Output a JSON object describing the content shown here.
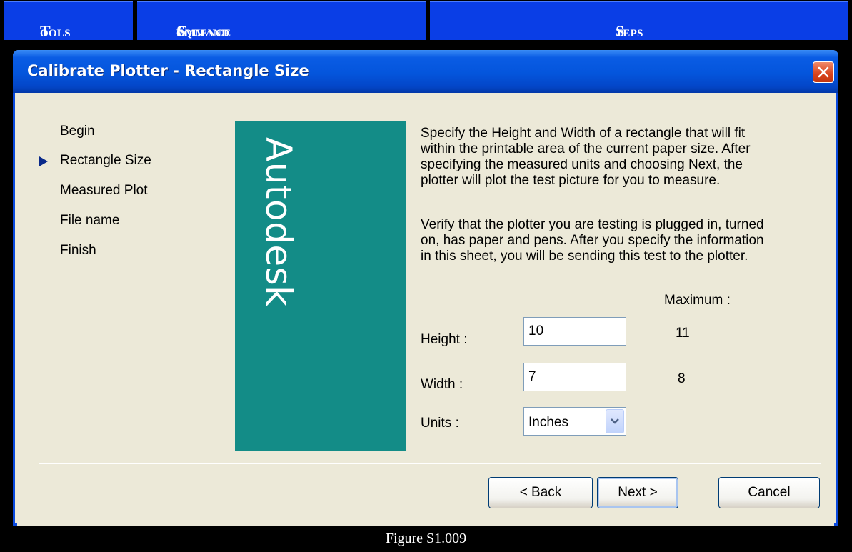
{
  "nav": {
    "tools": {
      "cap": "T",
      "rest": "ools"
    },
    "command_sequence": {
      "cap1": "C",
      "rest1": "ommand ",
      "cap2": "S",
      "rest2": "equence"
    },
    "steps": {
      "cap": "S",
      "rest": "teps"
    },
    "color": "#0a3ee6"
  },
  "dialog": {
    "title": "Calibrate Plotter - Rectangle Size",
    "steps": [
      "Begin",
      "Rectangle Size",
      "Measured Plot",
      "File name",
      "Finish"
    ],
    "current_step": "Rectangle Size",
    "banner": {
      "text": "Autodesk",
      "color": "#138c87"
    },
    "paragraph1": [
      "Specify the Height and Width of a rectangle that will fit",
      "within the printable area of the current paper size. After",
      "specifying the measured units and choosing Next, the",
      "plotter will plot the test picture for you to measure."
    ],
    "paragraph2": [
      "Verify that the plotter you are testing is plugged in, turned",
      "on, has paper and pens. After you specify the information",
      "in this sheet, you will be sending this test to the plotter."
    ],
    "maximum_label": "Maximum :",
    "height": {
      "label": "Height :",
      "value": "10",
      "max": "11"
    },
    "width": {
      "label": "Width :",
      "value": "7",
      "max": "8"
    },
    "units": {
      "label": "Units :",
      "value": "Inches"
    },
    "buttons": {
      "back": "< Back",
      "next": "Next >",
      "cancel": "Cancel"
    }
  },
  "caption": "Figure S1.009"
}
